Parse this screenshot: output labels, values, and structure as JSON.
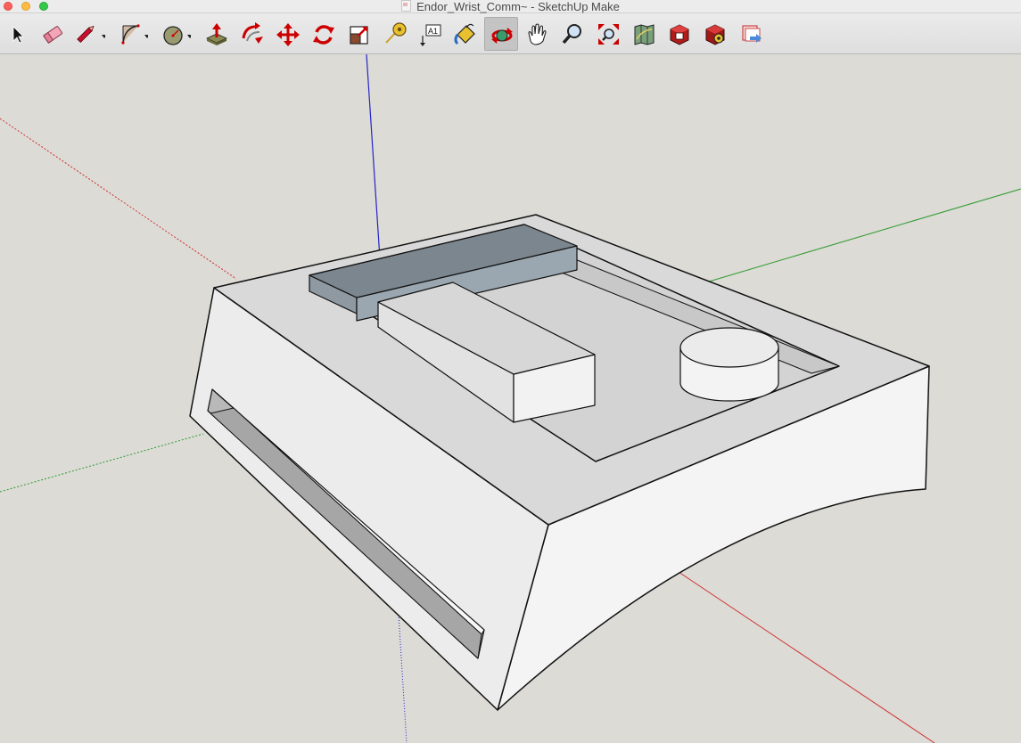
{
  "window": {
    "title": "Endor_Wrist_Comm~ - SketchUp Make"
  },
  "toolbar": {
    "tools": [
      {
        "icon": "select-icon",
        "name": "Select"
      },
      {
        "icon": "eraser-icon",
        "name": "Eraser"
      },
      {
        "icon": "pencil-icon",
        "name": "Line"
      },
      {
        "icon": "arc-icon",
        "name": "Arc"
      },
      {
        "icon": "circle-icon",
        "name": "Circle"
      },
      {
        "icon": "push-pull-icon",
        "name": "Push/Pull"
      },
      {
        "icon": "follow-me-icon",
        "name": "Follow Me"
      },
      {
        "icon": "move-icon",
        "name": "Move"
      },
      {
        "icon": "rotate-icon",
        "name": "Rotate"
      },
      {
        "icon": "scale-icon",
        "name": "Scale"
      },
      {
        "icon": "tape-measure-icon",
        "name": "Tape Measure"
      },
      {
        "icon": "text-icon",
        "name": "Text",
        "label": "A1"
      },
      {
        "icon": "paint-bucket-icon",
        "name": "Paint Bucket"
      },
      {
        "icon": "orbit-icon",
        "name": "Orbit",
        "active": true
      },
      {
        "icon": "pan-hand-icon",
        "name": "Pan"
      },
      {
        "icon": "zoom-icon",
        "name": "Zoom"
      },
      {
        "icon": "zoom-extents-icon",
        "name": "Zoom Extents"
      },
      {
        "icon": "map-icon",
        "name": "Add Location"
      },
      {
        "icon": "warehouse-icon",
        "name": "3D Warehouse"
      },
      {
        "icon": "extension-warehouse-icon",
        "name": "Extension Warehouse"
      },
      {
        "icon": "send-to-layout-icon",
        "name": "Send to LayOut"
      }
    ]
  },
  "colors": {
    "background": "#dcdbd6",
    "axis_red": "#d03030",
    "axis_green": "#2f9a2f",
    "axis_blue": "#2424c8",
    "model_face_light": "#f0f0f0",
    "model_face_top": "#d9d9d9",
    "model_selected": "#8a969e"
  }
}
